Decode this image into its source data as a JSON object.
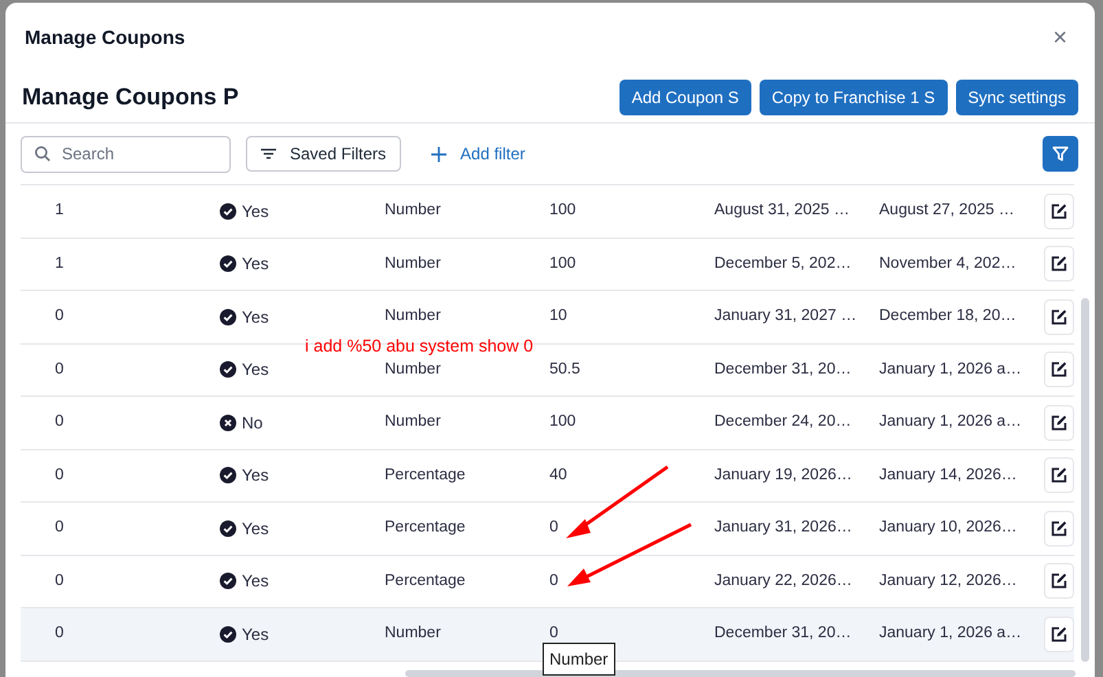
{
  "dialog": {
    "title": "Manage Coupons",
    "close": "×"
  },
  "page": {
    "title": "Manage Coupons P",
    "buttons": [
      "Add Coupon S",
      "Copy to Franchise 1 S",
      "Sync settings"
    ]
  },
  "filters": {
    "search": {
      "placeholder": "Search"
    },
    "saved_filters": "Saved Filters",
    "add_filter": "Add filter"
  },
  "table": {
    "rows": [
      {
        "col_1": "1",
        "active": true,
        "status": "Yes",
        "type": "Number",
        "amount": "100",
        "date_1": "August 31, 2025 …",
        "date_2": "August 27, 2025 …",
        "hovered": false
      },
      {
        "col_1": "1",
        "active": true,
        "status": "Yes",
        "type": "Number",
        "amount": "100",
        "date_1": "December 5, 202…",
        "date_2": "November 4, 202…",
        "hovered": false
      },
      {
        "col_1": "0",
        "active": true,
        "status": "Yes",
        "type": "Number",
        "amount": "10",
        "date_1": "January 31, 2027 …",
        "date_2": "December 18, 20…",
        "hovered": false
      },
      {
        "col_1": "0",
        "active": true,
        "status": "Yes",
        "type": "Number",
        "amount": "50.5",
        "date_1": "December 31, 20…",
        "date_2": "January 1, 2026 a…",
        "hovered": false
      },
      {
        "col_1": "0",
        "active": false,
        "status": "No",
        "type": "Number",
        "amount": "100",
        "date_1": "December 24, 20…",
        "date_2": "January 1, 2026 a…",
        "hovered": false
      },
      {
        "col_1": "0",
        "active": true,
        "status": "Yes",
        "type": "Percentage",
        "amount": "40",
        "date_1": "January 19, 2026…",
        "date_2": "January 14, 2026…",
        "hovered": false
      },
      {
        "col_1": "0",
        "active": true,
        "status": "Yes",
        "type": "Percentage",
        "amount": "0",
        "date_1": "January 31, 2026…",
        "date_2": "January 10, 2026…",
        "hovered": false
      },
      {
        "col_1": "0",
        "active": true,
        "status": "Yes",
        "type": "Percentage",
        "amount": "0",
        "date_1": "January 22, 2026…",
        "date_2": "January 12, 2026…",
        "hovered": false
      },
      {
        "col_1": "0",
        "active": true,
        "status": "Yes",
        "type": "Number",
        "amount": "0",
        "date_1": "December 31, 20…",
        "date_2": "January 1, 2026 a…",
        "hovered": true
      }
    ]
  },
  "tooltip": "Number",
  "annotation": {
    "note": "i add %50 abu system show 0"
  }
}
